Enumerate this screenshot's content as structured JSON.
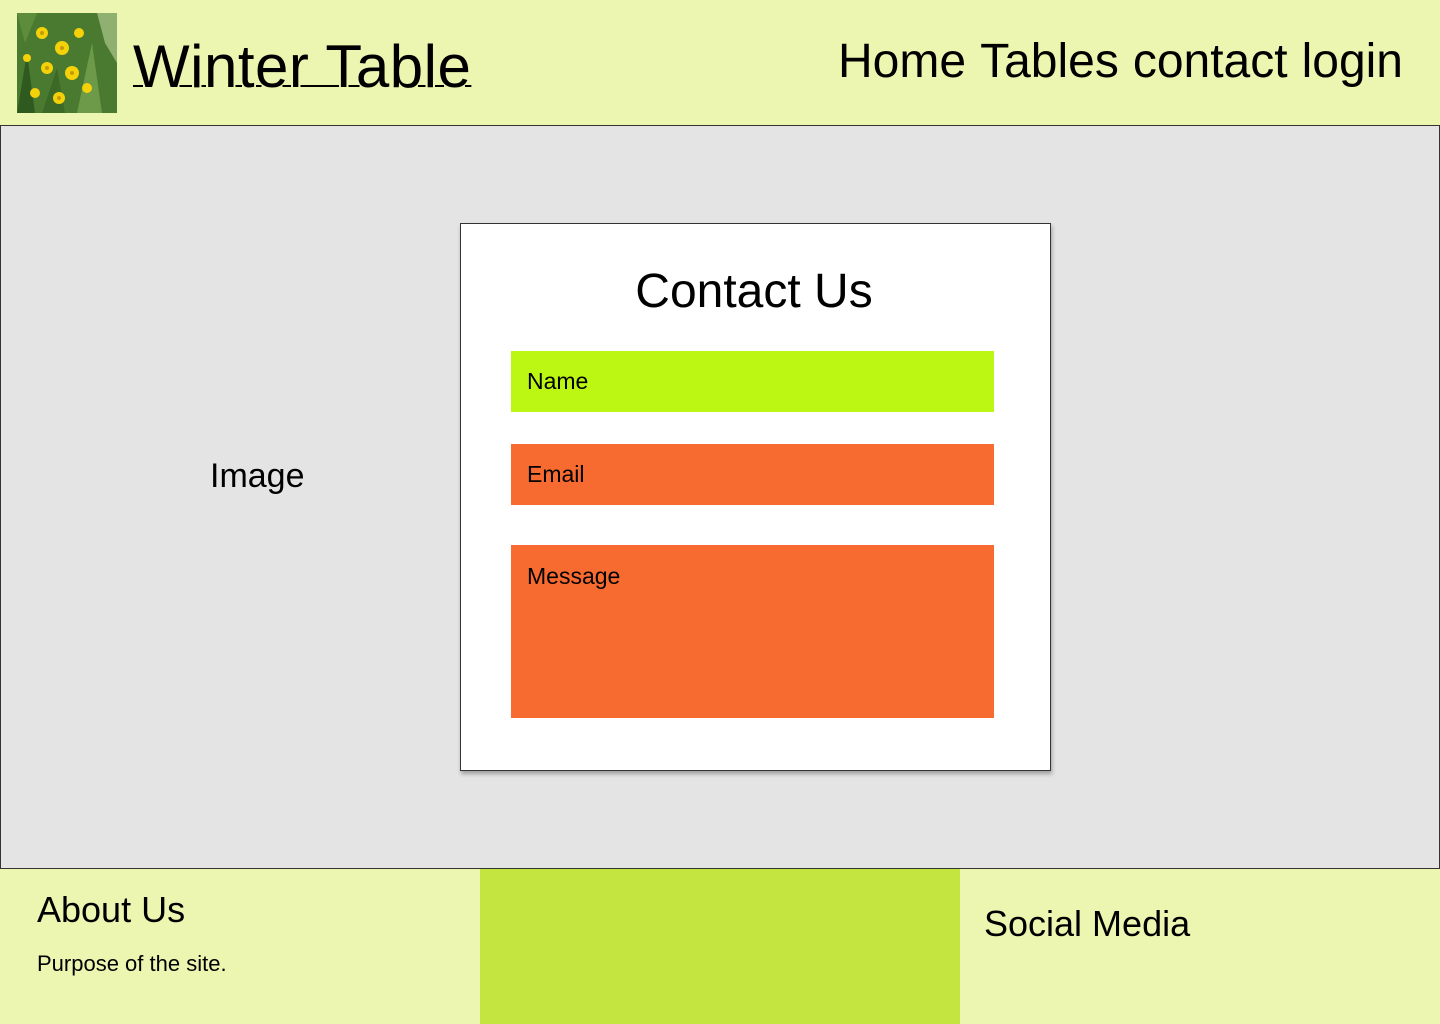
{
  "header": {
    "logo_icon": "yellow-flowers-photo",
    "site_title": "Winter Table",
    "nav": [
      "Home",
      "Tables",
      "contact",
      "login"
    ]
  },
  "hero": {
    "image_placeholder": "Image"
  },
  "contact": {
    "title": "Contact Us",
    "name_placeholder": "Name",
    "email_placeholder": "Email",
    "message_placeholder": "Message"
  },
  "footer": {
    "about_title": "About Us",
    "about_text": "Purpose of the site.",
    "social_title": "Social Media"
  },
  "colors": {
    "header_bg": "#ecf6b0",
    "hero_bg": "#e4e4e4",
    "name_field": "#bcf713",
    "email_field": "#f76a30",
    "message_field": "#f76a30",
    "footer_mid": "#c4e440"
  }
}
